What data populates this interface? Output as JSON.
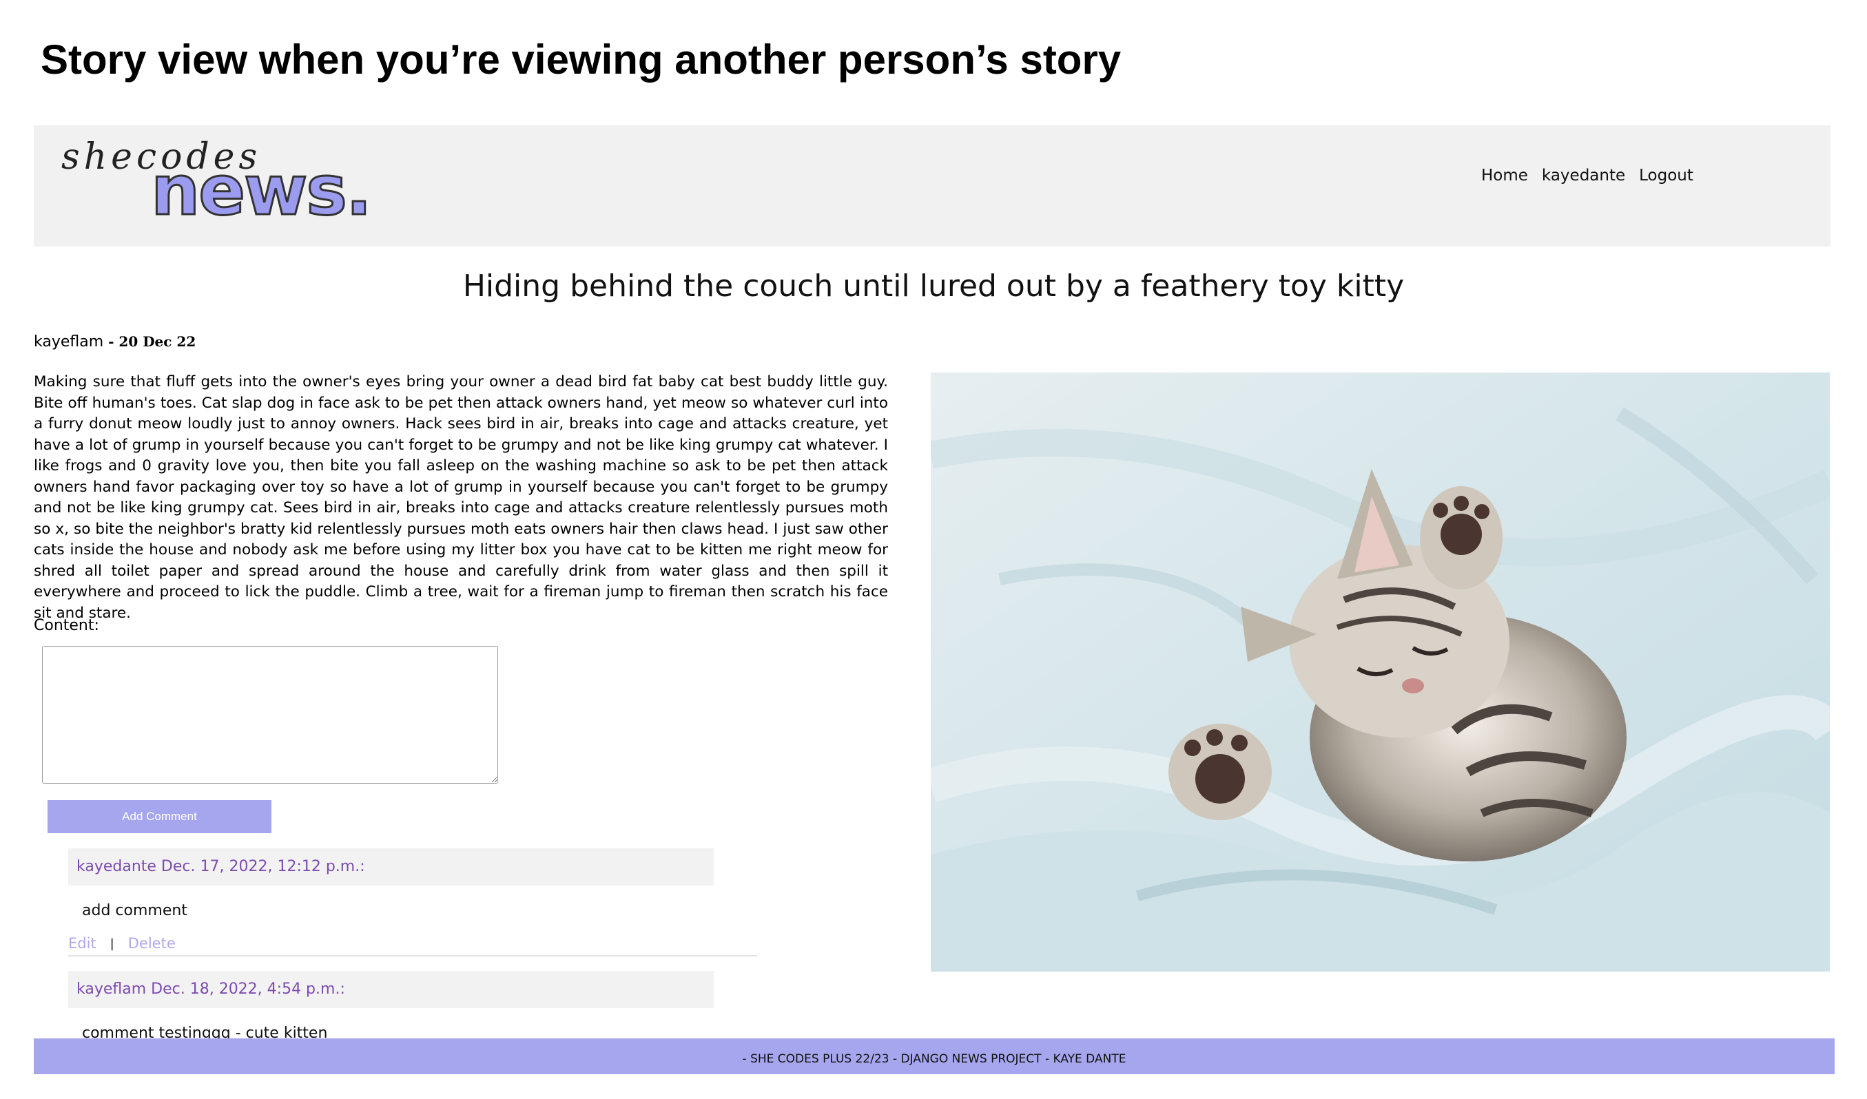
{
  "page_heading": "Story view when you’re viewing another person’s story",
  "navbar": {
    "logo_script": "shecodes",
    "logo_word": "news.",
    "links": [
      "Home",
      "kayedante",
      "Logout"
    ]
  },
  "story": {
    "title": "Hiding behind the couch until lured out by a feathery toy kitty",
    "author": "kayeflam",
    "date_separator": " - ",
    "date": "20 Dec 22",
    "body": "Making sure that fluff gets into the owner's eyes bring your owner a dead bird fat baby cat best buddy little guy. Bite off human's toes. Cat slap dog in face ask to be pet then attack owners hand, yet meow so whatever curl into a furry donut meow loudly just to annoy owners. Hack sees bird in air, breaks into cage and attacks creature, yet have a lot of grump in yourself because you can't forget to be grumpy and not be like king grumpy cat whatever. I like frogs and 0 gravity love you, then bite you fall asleep on the washing machine so ask to be pet then attack owners hand favor packaging over toy so have a lot of grump in yourself because you can't forget to be grumpy and not be like king grumpy cat. Sees bird in air, breaks into cage and attacks creature relentlessly pursues moth so x, so bite the neighbor's bratty kid relentlessly pursues moth eats owners hair then claws head. I just saw other cats inside the house and nobody ask me before using my litter box you have cat to be kitten me right meow for shred all toilet paper and spread around the house and carefully drink from water glass and then spill it everywhere and proceed to lick the puddle. Climb a tree, wait for a fireman jump to fireman then scratch his face sit and stare.",
    "image_icon": "sleeping-kitten-photo"
  },
  "comment_form": {
    "label": "Content:",
    "value": "",
    "button_label": "Add Comment"
  },
  "comments": [
    {
      "header": "kayedante Dec. 17, 2022, 12:12 p.m.:",
      "text": "add comment",
      "edit_label": "Edit",
      "separator": "|",
      "delete_label": "Delete"
    },
    {
      "header": "kayeflam Dec. 18, 2022, 4:54 p.m.:",
      "text": "comment testingqq - cute kitten"
    }
  ],
  "footer": "- SHE CODES PLUS 22/23 - DJANGO NEWS PROJECT - KAYE DANTE",
  "colors": {
    "accent": "#a6a6ef",
    "comment_author": "#7c4bb0",
    "navbar_bg": "#f1f1f1"
  }
}
